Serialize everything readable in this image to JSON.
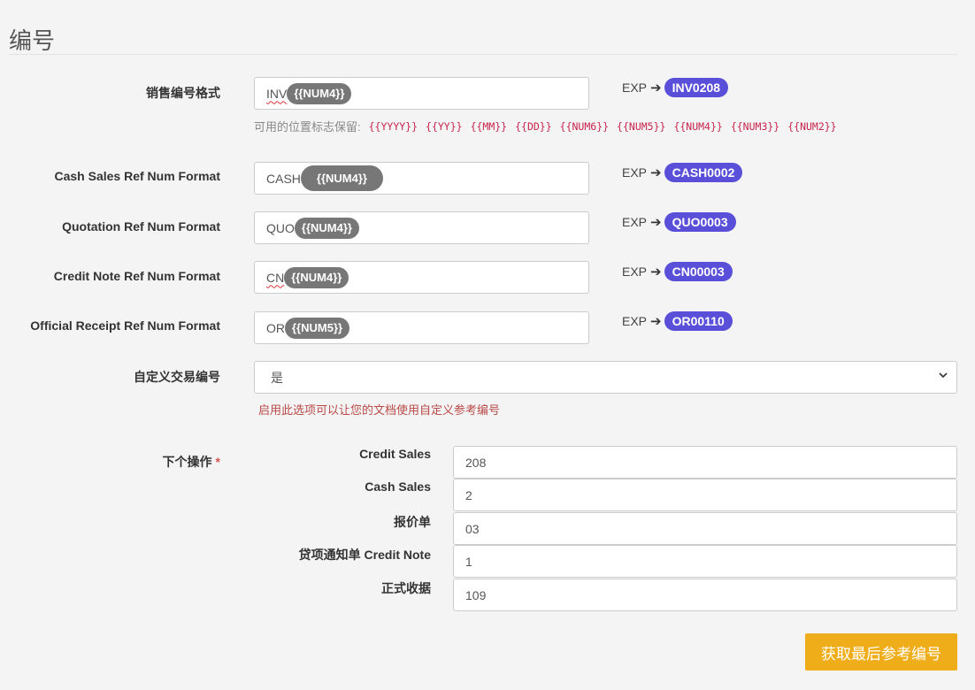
{
  "page": {
    "title": "编号"
  },
  "formats": [
    {
      "label": "销售编号格式",
      "prefix": "INV",
      "token": "{{NUM4}}",
      "example_prefix": "EXP",
      "example": "INV0208"
    },
    {
      "label": "Cash Sales Ref Num Format",
      "prefix": "CASH",
      "token": "{{NUM4}}",
      "example_prefix": "EXP",
      "example": "CASH0002"
    },
    {
      "label": "Quotation Ref Num Format",
      "prefix": "QUO",
      "token": "{{NUM4}}",
      "example_prefix": "EXP",
      "example": "QUO0003"
    },
    {
      "label": "Credit Note Ref Num Format",
      "prefix": "CN",
      "token": "{{NUM4}}",
      "example_prefix": "EXP",
      "example": "CN00003"
    },
    {
      "label": "Official Receipt Ref Num Format",
      "prefix": "OR",
      "token": "{{NUM5}}",
      "example_prefix": "EXP",
      "example": "OR00110"
    }
  ],
  "placeholder_help": {
    "text": "可用的位置标志保留:",
    "tokens": [
      "{{YYYY}}",
      "{{YY}}",
      "{{MM}}",
      "{{DD}}",
      "{{NUM6}}",
      "{{NUM5}}",
      "{{NUM4}}",
      "{{NUM3}}",
      "{{NUM2}}"
    ]
  },
  "custom_number": {
    "label": "自定义交易编号",
    "selected": "是",
    "help": "启用此选项可以让您的文档使用自定义参考编号"
  },
  "next_action": {
    "label": "下个操作",
    "required_mark": "*",
    "rows": [
      {
        "label": "Credit Sales",
        "value": "208"
      },
      {
        "label": "Cash Sales",
        "value": "2"
      },
      {
        "label": "报价单",
        "value": "03"
      },
      {
        "label": "贷项通知单 Credit Note",
        "value": "1"
      },
      {
        "label": "正式收据",
        "value": "109"
      }
    ]
  },
  "actions": {
    "fetch_label": "获取最后参考编号"
  },
  "colors": {
    "badge": "#5a4fd9",
    "token": "#777777",
    "button": "#f0ad1a",
    "help_error": "#b94a48",
    "code": "#c7254e"
  }
}
